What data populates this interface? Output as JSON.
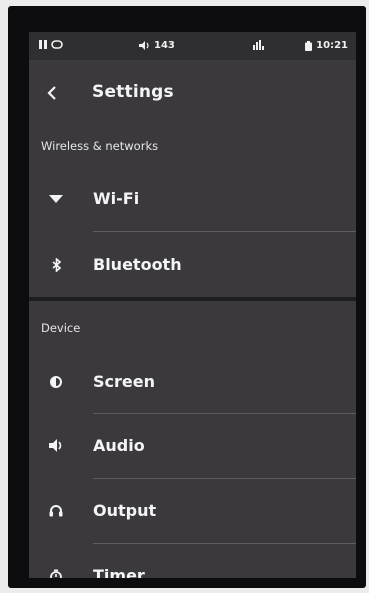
{
  "status_bar": {
    "left_icons": [
      "pause-icon",
      "loop-icon"
    ],
    "volume": "143",
    "time": "10:21"
  },
  "header": {
    "back_icon": "chevron-left-icon",
    "title": "Settings"
  },
  "sections": [
    {
      "title": "Wireless & networks",
      "items": [
        {
          "label": "Wi-Fi",
          "icon": "wifi-icon"
        },
        {
          "label": "Bluetooth",
          "icon": "bluetooth-icon"
        }
      ]
    },
    {
      "title": "Device",
      "items": [
        {
          "label": "Screen",
          "icon": "brightness-icon"
        },
        {
          "label": "Audio",
          "icon": "speaker-icon"
        },
        {
          "label": "Output",
          "icon": "headphones-icon"
        },
        {
          "label": "Timer",
          "icon": "timer-icon"
        }
      ]
    }
  ]
}
